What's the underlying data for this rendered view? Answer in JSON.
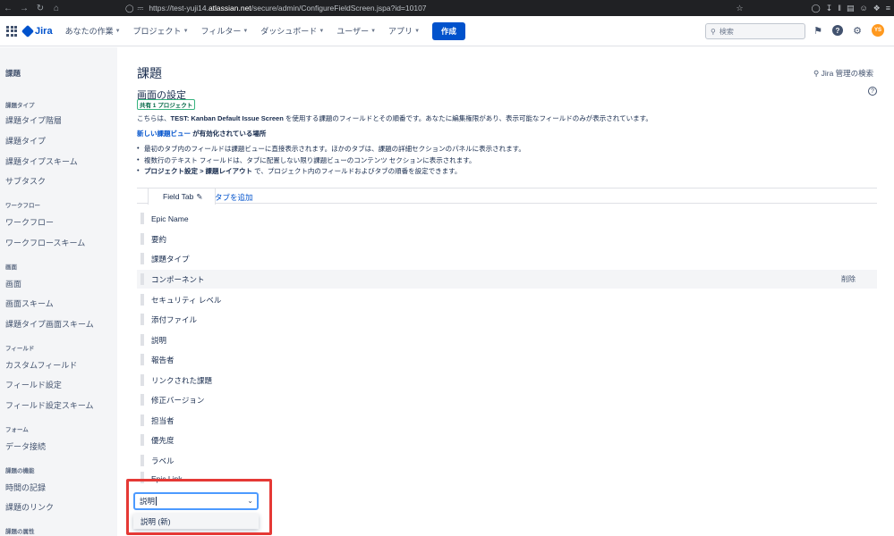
{
  "browser": {
    "url_prefix": "https://test-yuji14.",
    "url_host": "atlassian.net",
    "url_path": "/secure/admin/ConfigureFieldScreen.jspa?id=10107"
  },
  "header": {
    "logo": "Jira",
    "nav": [
      {
        "label": "あなたの作業"
      },
      {
        "label": "プロジェクト"
      },
      {
        "label": "フィルター"
      },
      {
        "label": "ダッシュボード"
      },
      {
        "label": "ユーザー"
      },
      {
        "label": "アプリ"
      }
    ],
    "create_label": "作成",
    "search_placeholder": "検索",
    "avatar_initials": "YS"
  },
  "sidebar": {
    "heading": "課題",
    "sections": [
      {
        "title": "課題タイプ",
        "items": [
          "課題タイプ階層",
          "課題タイプ",
          "課題タイプスキーム",
          "サブタスク"
        ]
      },
      {
        "title": "ワークフロー",
        "items": [
          "ワークフロー",
          "ワークフロースキーム"
        ]
      },
      {
        "title": "画面",
        "items": [
          "画面",
          "画面スキーム",
          "課題タイプ画面スキーム"
        ]
      },
      {
        "title": "フィールド",
        "items": [
          "カスタムフィールド",
          "フィールド設定",
          "フィールド設定スキーム"
        ]
      },
      {
        "title": "フォーム",
        "items": [
          "データ接続"
        ]
      },
      {
        "title": "課題の機能",
        "items": [
          "時間の記録",
          "課題のリンク"
        ]
      },
      {
        "title": "課題の属性",
        "items": []
      }
    ]
  },
  "main": {
    "title": "課題",
    "jira_search": "Jira 管理の検索",
    "subtitle": "画面の設定",
    "shared_badge": "共有 1 プロジェクト",
    "desc_pre": "こちらは、",
    "desc_screen": "TEST: Kanban Default Issue Screen",
    "desc_post": " を使用する課題のフィールドとその順番です。あなたに編集権限があり、表示可能なフィールドのみが表示されています。",
    "new_view_link": "新しい課題ビュー",
    "new_view_rest": " が有効化されている場所",
    "bullet1": "最初のタブ内のフィールドは課題ビューに直接表示されます。ほかのタブは、課題の詳細セクションのパネルに表示されます。",
    "bullet2": "複数行のテキスト フィールドは、タブに配置しない限り課題ビューのコンテンツ セクションに表示されます。",
    "bullet3_bold": "プロジェクト設定 > 課題レイアウト",
    "bullet3_rest": " で、プロジェクト内のフィールドおよびタブの順番を設定できます。",
    "tab_label": "Field Tab",
    "add_tab": "タブを追加",
    "remove_label": "削除",
    "fields": [
      "Epic Name",
      "要約",
      "課題タイプ",
      "コンポーネント",
      "セキュリティ レベル",
      "添付ファイル",
      "説明",
      "報告者",
      "リンクされた課題",
      "修正バージョン",
      "担当者",
      "優先度",
      "ラベル",
      "Epic Link"
    ],
    "add_field": {
      "value": "説明",
      "options": [
        "説明 (新)"
      ]
    }
  }
}
